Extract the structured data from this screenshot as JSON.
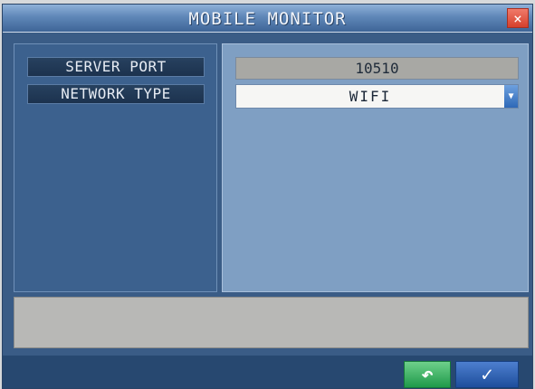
{
  "window": {
    "title": "MOBILE MONITOR",
    "close_glyph": "×"
  },
  "labels": {
    "server_port": "SERVER PORT",
    "network_type": "NETWORK TYPE"
  },
  "fields": {
    "server_port_value": "10510",
    "network_type_value": "WIFI",
    "dropdown_glyph": "▼"
  },
  "footer": {
    "back_glyph": "↶",
    "ok_glyph": "✓"
  },
  "icons": {
    "close": "close-icon",
    "dropdown": "chevron-down-icon",
    "back": "back-icon",
    "ok": "checkmark-icon"
  },
  "colors": {
    "title_bar": "#5f87b8",
    "close_button": "#d6402c",
    "back_button": "#1f9a4a",
    "ok_button": "#1e4e9c"
  }
}
